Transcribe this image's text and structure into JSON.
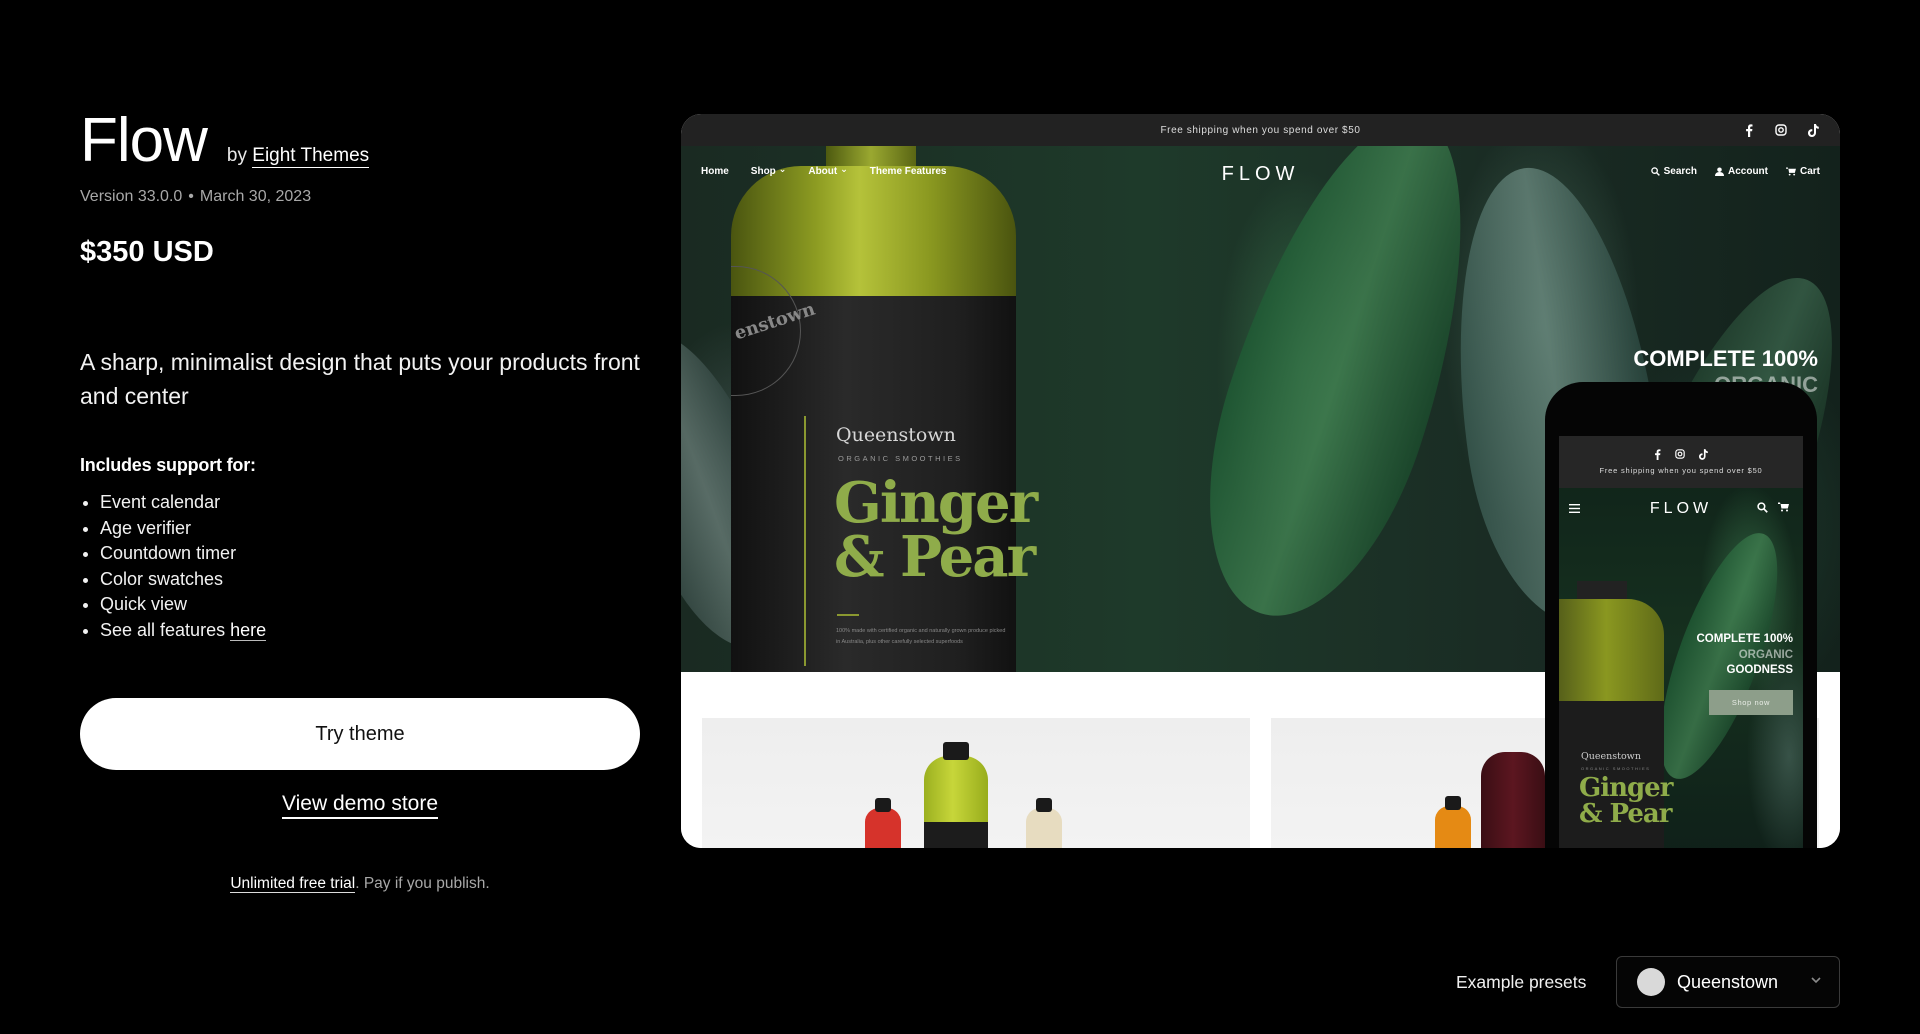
{
  "theme": {
    "name": "Flow",
    "by_prefix": "by",
    "author": "Eight Themes",
    "version": "Version 33.0.0",
    "separator": "•",
    "release_date": "March 30, 2023",
    "price": "$350 USD",
    "tagline": "A sharp, minimalist design that puts your products front and center",
    "includes_heading": "Includes support for:",
    "features": [
      "Event calendar",
      "Age verifier",
      "Countdown timer",
      "Color swatches",
      "Quick view"
    ],
    "see_all_prefix": "See all features",
    "see_all_link": "here"
  },
  "actions": {
    "try_theme": "Try theme",
    "view_demo": "View demo store",
    "trial_link": "Unlimited free trial",
    "trial_suffix": ". Pay if you publish."
  },
  "preview": {
    "desktop": {
      "announcement": "Free shipping when you spend over $50",
      "socials": [
        "facebook",
        "instagram",
        "tiktok"
      ],
      "nav": [
        {
          "label": "Home",
          "dropdown": false
        },
        {
          "label": "Shop",
          "dropdown": true
        },
        {
          "label": "About",
          "dropdown": true
        },
        {
          "label": "Theme Features",
          "dropdown": false
        }
      ],
      "logo": "FLOW",
      "utilities": {
        "search": "Search",
        "account": "Account",
        "cart": "Cart"
      },
      "hero_line1": "COMPLETE 100%",
      "hero_line2": "ORGANIC",
      "bottle_brand": "Queenstown",
      "bottle_sub": "ORGANIC SMOOTHIES",
      "bottle_flavor_1": "Ginger",
      "bottle_flavor_2": "& Pear",
      "bottle_fine": "100% made with certified organic and naturally grown produce picked in Australia, plus other carefully selected superfoods",
      "seal_text": "enstown"
    },
    "mobile": {
      "announcement": "Free shipping when you spend over $50",
      "logo": "FLOW",
      "hero_line1": "COMPLETE 100%",
      "hero_line2": "ORGANIC",
      "hero_line3": "GOODNESS",
      "shop_now": "Shop now",
      "bottle_brand": "Queenstown",
      "bottle_sub": "ORGANIC SMOOTHIES",
      "bottle_flavor_1": "Ginger",
      "bottle_flavor_2": "& Pear"
    }
  },
  "presets": {
    "label": "Example presets",
    "selected": "Queenstown",
    "swatch_color": "#d9d9d9"
  },
  "colors": {
    "background": "#000000",
    "button_bg": "#ffffff",
    "muted_text": "#a8a8a8",
    "flavor_green": "#8fac4a",
    "shop_now_bg": "#8d9e8a"
  }
}
